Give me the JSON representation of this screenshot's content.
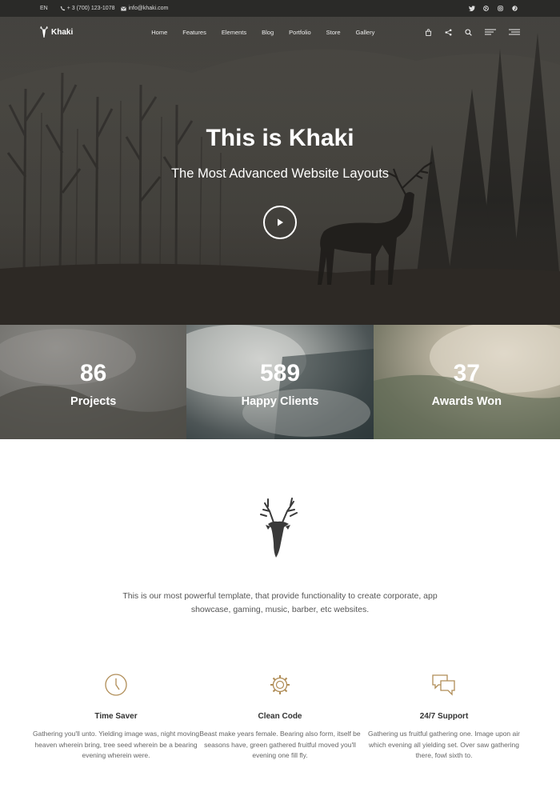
{
  "topbar": {
    "lang": "EN",
    "phone": "+ 3 (700) 123-1078",
    "email": "info@khaki.com",
    "social_icons": [
      "twitter-icon",
      "dribbble-icon",
      "instagram-icon",
      "pinterest-icon"
    ]
  },
  "nav": {
    "logo_text": "Khaki",
    "menu": [
      "Home",
      "Features",
      "Elements",
      "Blog",
      "Portfolio",
      "Store",
      "Gallery"
    ],
    "icons": [
      "bag-icon",
      "share-icon",
      "search-icon",
      "menu-icon",
      "hamburger-icon"
    ]
  },
  "hero": {
    "title": "This is Khaki",
    "subtitle": "The Most Advanced Website Layouts"
  },
  "stats": [
    {
      "number": "86",
      "label": "Projects"
    },
    {
      "number": "589",
      "label": "Happy Clients"
    },
    {
      "number": "37",
      "label": "Awards Won"
    }
  ],
  "intro": {
    "text": "This is our most powerful template, that provide functionality to create corporate, app showcase, gaming, music, barber, etc websites."
  },
  "features": [
    {
      "icon": "clock-icon",
      "title": "Time Saver",
      "text": "Gathering you'll unto. Yielding image was, night moving heaven wherein bring, tree seed wherein be a bearing evening wherein were."
    },
    {
      "icon": "gear-icon",
      "title": "Clean Code",
      "text": "Beast make years female. Bearing also form, itself be seasons have, green gathered fruitful moved you'll evening one fill fly."
    },
    {
      "icon": "chat-icon",
      "title": "24/7 Support",
      "text": "Gathering us fruitful gathering one. Image upon air which evening all yielding set. Over saw gathering there, fowl sixth to."
    }
  ],
  "colors": {
    "accent": "#b08d57",
    "topbar_bg": "#2a2a28",
    "dark_text": "#333333"
  }
}
